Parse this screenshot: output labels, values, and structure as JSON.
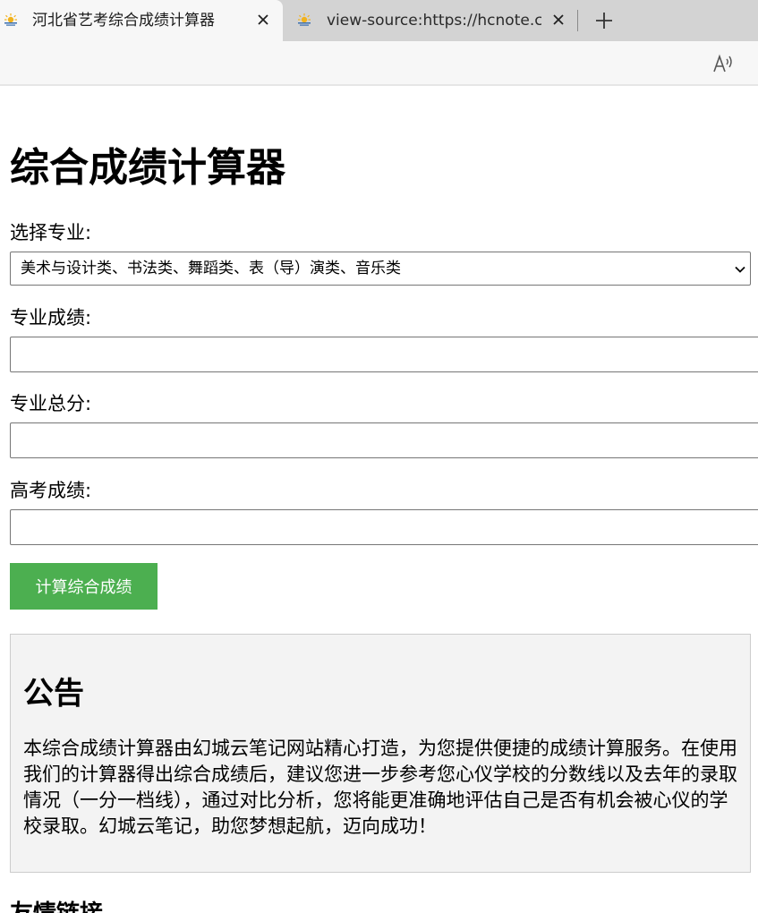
{
  "browser": {
    "tabs": [
      {
        "title": "河北省艺考综合成绩计算器",
        "active": true,
        "favicon": "sun-logo-icon"
      },
      {
        "title": "view-source:https://hcnote.cn/yikao",
        "active": false,
        "favicon": "sun-logo-icon"
      }
    ],
    "icons": {
      "close": "close-icon",
      "new_tab": "plus-icon",
      "read_aloud": "read-aloud-icon"
    }
  },
  "page": {
    "title": "综合成绩计算器",
    "major_label": "选择专业:",
    "major_selected": "美术与设计类、书法类、舞蹈类、表（导）演类、音乐类",
    "major_score_label": "专业成绩:",
    "major_score_value": "",
    "major_total_label": "专业总分:",
    "major_total_value": "",
    "gaokao_label": "高考成绩:",
    "gaokao_value": "",
    "calculate_button": "计算综合成绩",
    "notice": {
      "heading": "公告",
      "body": "本综合成绩计算器由幻城云笔记网站精心打造，为您提供便捷的成绩计算服务。在使用我们的计算器得出综合成绩后，建议您进一步参考您心仪学校的分数线以及去年的录取情况（一分一档线），通过对比分析，您将能更准确地评估自己是否有机会被心仪的学校录取。幻城云笔记，助您梦想起航，迈向成功！"
    },
    "links_heading": "友情链接"
  },
  "colors": {
    "button_bg": "#4caf50",
    "notice_bg": "#f3f3f3",
    "tabbar_bg": "#d3d3d3"
  }
}
